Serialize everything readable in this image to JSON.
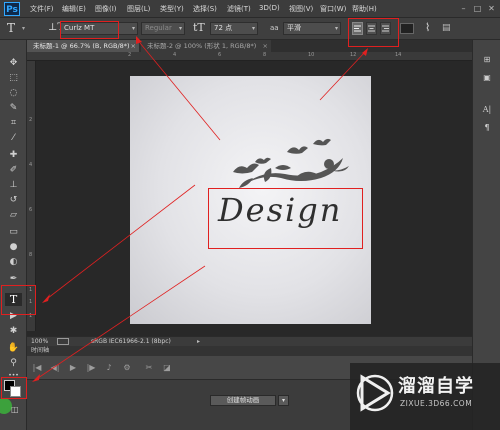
{
  "app": {
    "logo": "Ps"
  },
  "menu": [
    "文件(F)",
    "编辑(E)",
    "图像(I)",
    "图层(L)",
    "类型(Y)",
    "选择(S)",
    "滤镜(T)",
    "3D(D)",
    "视图(V)",
    "窗口(W)",
    "帮助(H)"
  ],
  "options": {
    "font_family": "Curlz MT",
    "font_style": "Regular",
    "font_size": "72 点",
    "antialias_prefix": "aa",
    "antialias": "平滑",
    "align_active": "left"
  },
  "tabs": [
    {
      "label": "未标题-1 @ 66.7% (B, RGB/8*)",
      "active": true
    },
    {
      "label": "未标题-2 @ 100% (形状 1, RGB/8*)",
      "active": false
    }
  ],
  "ruler_top": [
    "2",
    "4",
    "6",
    "8",
    "10",
    "12",
    "14"
  ],
  "ruler_left": [
    "2",
    "4",
    "6",
    "8",
    "1",
    "1",
    "1"
  ],
  "canvas": {
    "text": "Design"
  },
  "status": {
    "zoom": "100%",
    "profile": "sRGB IEC61966-2.1 (8bpc)"
  },
  "timeline": {
    "title": "时间轴",
    "create_button": "创建帧动画"
  },
  "watermark": {
    "name": "溜溜自学",
    "url": "ZIXUE.3D66.COM"
  },
  "colors": {
    "annotation": "#e02020",
    "ps_accent": "#31a8ff",
    "panel": "#444444"
  }
}
